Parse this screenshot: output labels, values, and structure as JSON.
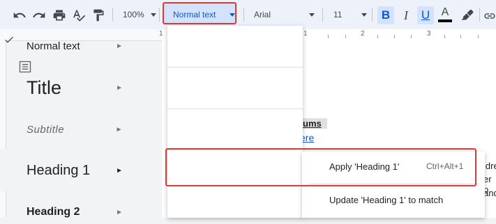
{
  "toolbar": {
    "zoom": "100%",
    "paragraph_style": "Normal text",
    "font": "Arial",
    "font_size": "11",
    "bold": "B",
    "italic": "I",
    "underline": "U",
    "text_color": "A",
    "icons": [
      "undo-icon",
      "redo-icon",
      "print-icon",
      "spellcheck-icon",
      "paint-format-icon",
      "highlighter-icon",
      "link-icon"
    ]
  },
  "ruler": {
    "marks": [
      "1",
      "1",
      "2",
      "3"
    ]
  },
  "menu": {
    "items": [
      {
        "label": "Normal text",
        "checked": true
      },
      {
        "label": "Title"
      },
      {
        "label": "Subtitle"
      },
      {
        "label": "Heading 1"
      },
      {
        "label": "Heading 2"
      }
    ],
    "arrow": "►"
  },
  "submenu": {
    "apply": "Apply 'Heading 1'",
    "shortcut": "Ctrl+Alt+1",
    "update": "Update 'Heading 1' to match"
  },
  "document": {
    "heading_fragment": "ums",
    "link_fragment": "ere",
    "right_fragments": [
      "ldre",
      "er p",
      "and"
    ]
  },
  "colors": {
    "accent": "#0b57d0",
    "highlight": "#e8372f",
    "toolbar_bg": "#edf2fa"
  }
}
